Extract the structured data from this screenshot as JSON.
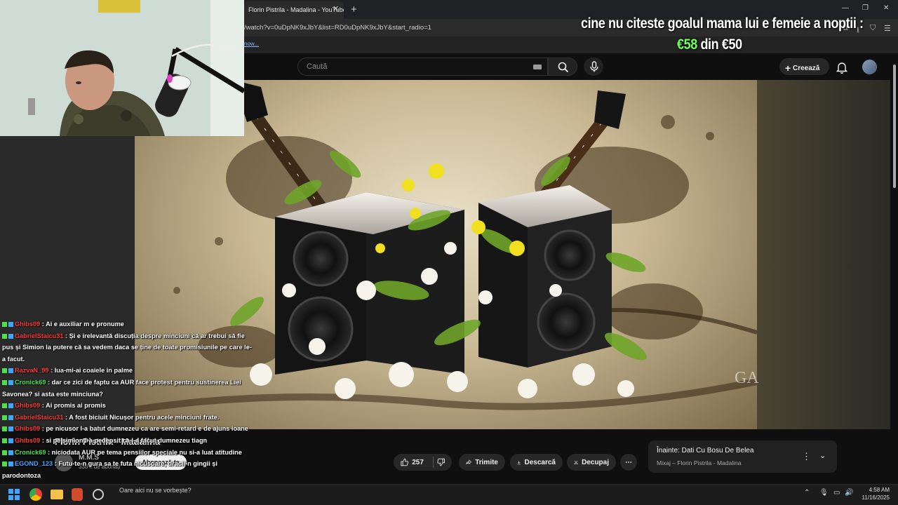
{
  "browser": {
    "tab_title": "Florin Pistrila - Madalina - YouTube",
    "url": "/watch?v=0uDpNK9xJbY&list=RD0uDpNK9xJbY&start_radio=1",
    "bookmark_fragment": "now..."
  },
  "overlay": {
    "title": "cine nu citeste goalul mama lui e femeie a noptii :",
    "donation_current": "€58",
    "donation_separator": "din",
    "donation_goal": "€50",
    "donation_color": "#6bff5a"
  },
  "youtube": {
    "search_placeholder": "Caută",
    "create_label": "Creează",
    "video_title": "Florin Pistrila - Madalina",
    "channel_name": "M.M.S",
    "subscribers": "338 k de abonați",
    "subscribe_label": "Abonează-te",
    "like_count": "257",
    "share_label": "Trimite",
    "download_label": "Descarcă",
    "clip_label": "Decupaj",
    "next_prefix": "Înainte:",
    "next_title": "Dati Cu Bosu De Belea",
    "next_sub": "Mixaj – Florin Pistrila - Madalina",
    "watermark": "GA"
  },
  "chat": {
    "messages": [
      {
        "user": "Ghibs09",
        "color": "#ff3b3b",
        "text": "Ai e auxiliar m e pronume"
      },
      {
        "user": "GabrielStaicu31",
        "color": "#ff3b3b",
        "text": "Și e irelevantă discuția despre minciuni că ar trebui să fie pus și Simion la putere că sa vedem daca se ține de toate promisiunile pe care le-a facut."
      },
      {
        "user": "RazvaN_99",
        "color": "#ff3b3b",
        "text": "lua-mi-ai coaiele in palme"
      },
      {
        "user": "Cronick69",
        "color": "#4be14b",
        "text": "dar ce zici de faptu ca AUR face protest pentru sustinerea Liei Savonea? si asta este minciuna?"
      },
      {
        "user": "Ghibs09",
        "color": "#ff3b3b",
        "text": "Ai promis ai promis"
      },
      {
        "user": "GabrielStaicu31",
        "color": "#ff3b3b",
        "text": "A fost biciuit Nicușor pentru acele minciuni frate."
      },
      {
        "user": "Ghibs09",
        "color": "#ff3b3b",
        "text": "pe nicusor l-a batut dumnezeu ca are semi-retard e de ajuns ioane"
      },
      {
        "user": "Ghibs09",
        "color": "#ff3b3b",
        "text": "si pe simion l-a pedepsit ca l-a facut dumnezeu tiagn"
      },
      {
        "user": "Cronick69",
        "color": "#4be14b",
        "text": "niciodata AUR pe tema pensiilor speciale nu si-a luat atitudine"
      },
      {
        "user": "EGOND_123",
        "color": "#4aa3ff",
        "text": "Futu-te-n gura sa te futa nicusoare, dracii-n gingii și parodontoza"
      }
    ]
  },
  "taskbar": {
    "search_text": "Oare aici nu se vorbește?",
    "time": "4:58 AM",
    "date": "11/16/2025"
  }
}
